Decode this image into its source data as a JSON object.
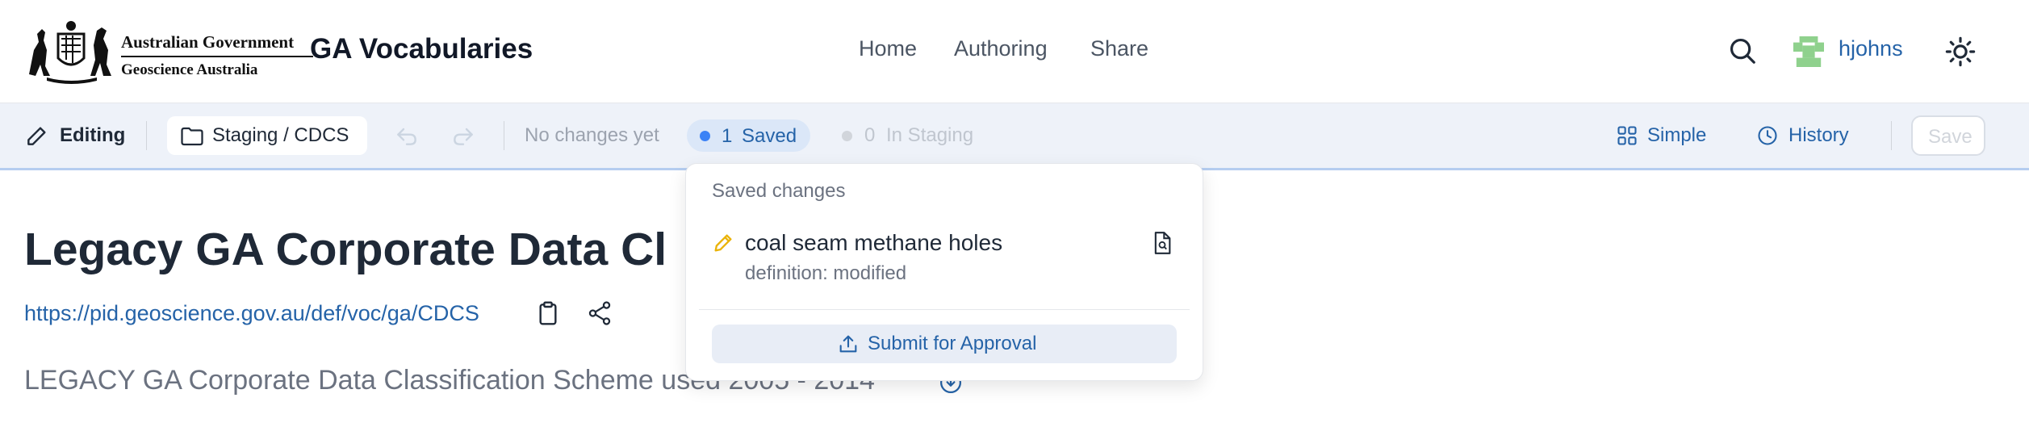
{
  "header": {
    "logo": {
      "line1": "Australian Government",
      "line2": "Geoscience Australia"
    },
    "app_title": "GA Vocabularies",
    "nav": [
      "Home",
      "Authoring",
      "Share"
    ],
    "user_name": "hjohns"
  },
  "toolbar": {
    "mode_label": "Editing",
    "location_label": "Staging / CDCS",
    "no_changes_label": "No changes yet",
    "saved_count": "1",
    "saved_label": "Saved",
    "staging_count": "0",
    "staging_label": "In Staging",
    "simple_label": "Simple",
    "history_label": "History",
    "save_label": "Save",
    "colors": {
      "saved_dot": "#3b82f6",
      "staging_dot": "#d1d5db",
      "accent_border": "#b5cdf0"
    }
  },
  "main": {
    "title": "Legacy GA Corporate Data Cl",
    "uri": "https://pid.geoscience.gov.au/def/voc/ga/CDCS",
    "description": "LEGACY GA Corporate Data Classification Scheme used 2005 - 2014"
  },
  "popover": {
    "title": "Saved changes",
    "changes": [
      {
        "name": "coal seam methane holes",
        "detail": "definition: modified"
      }
    ],
    "submit_label": "Submit for Approval"
  }
}
